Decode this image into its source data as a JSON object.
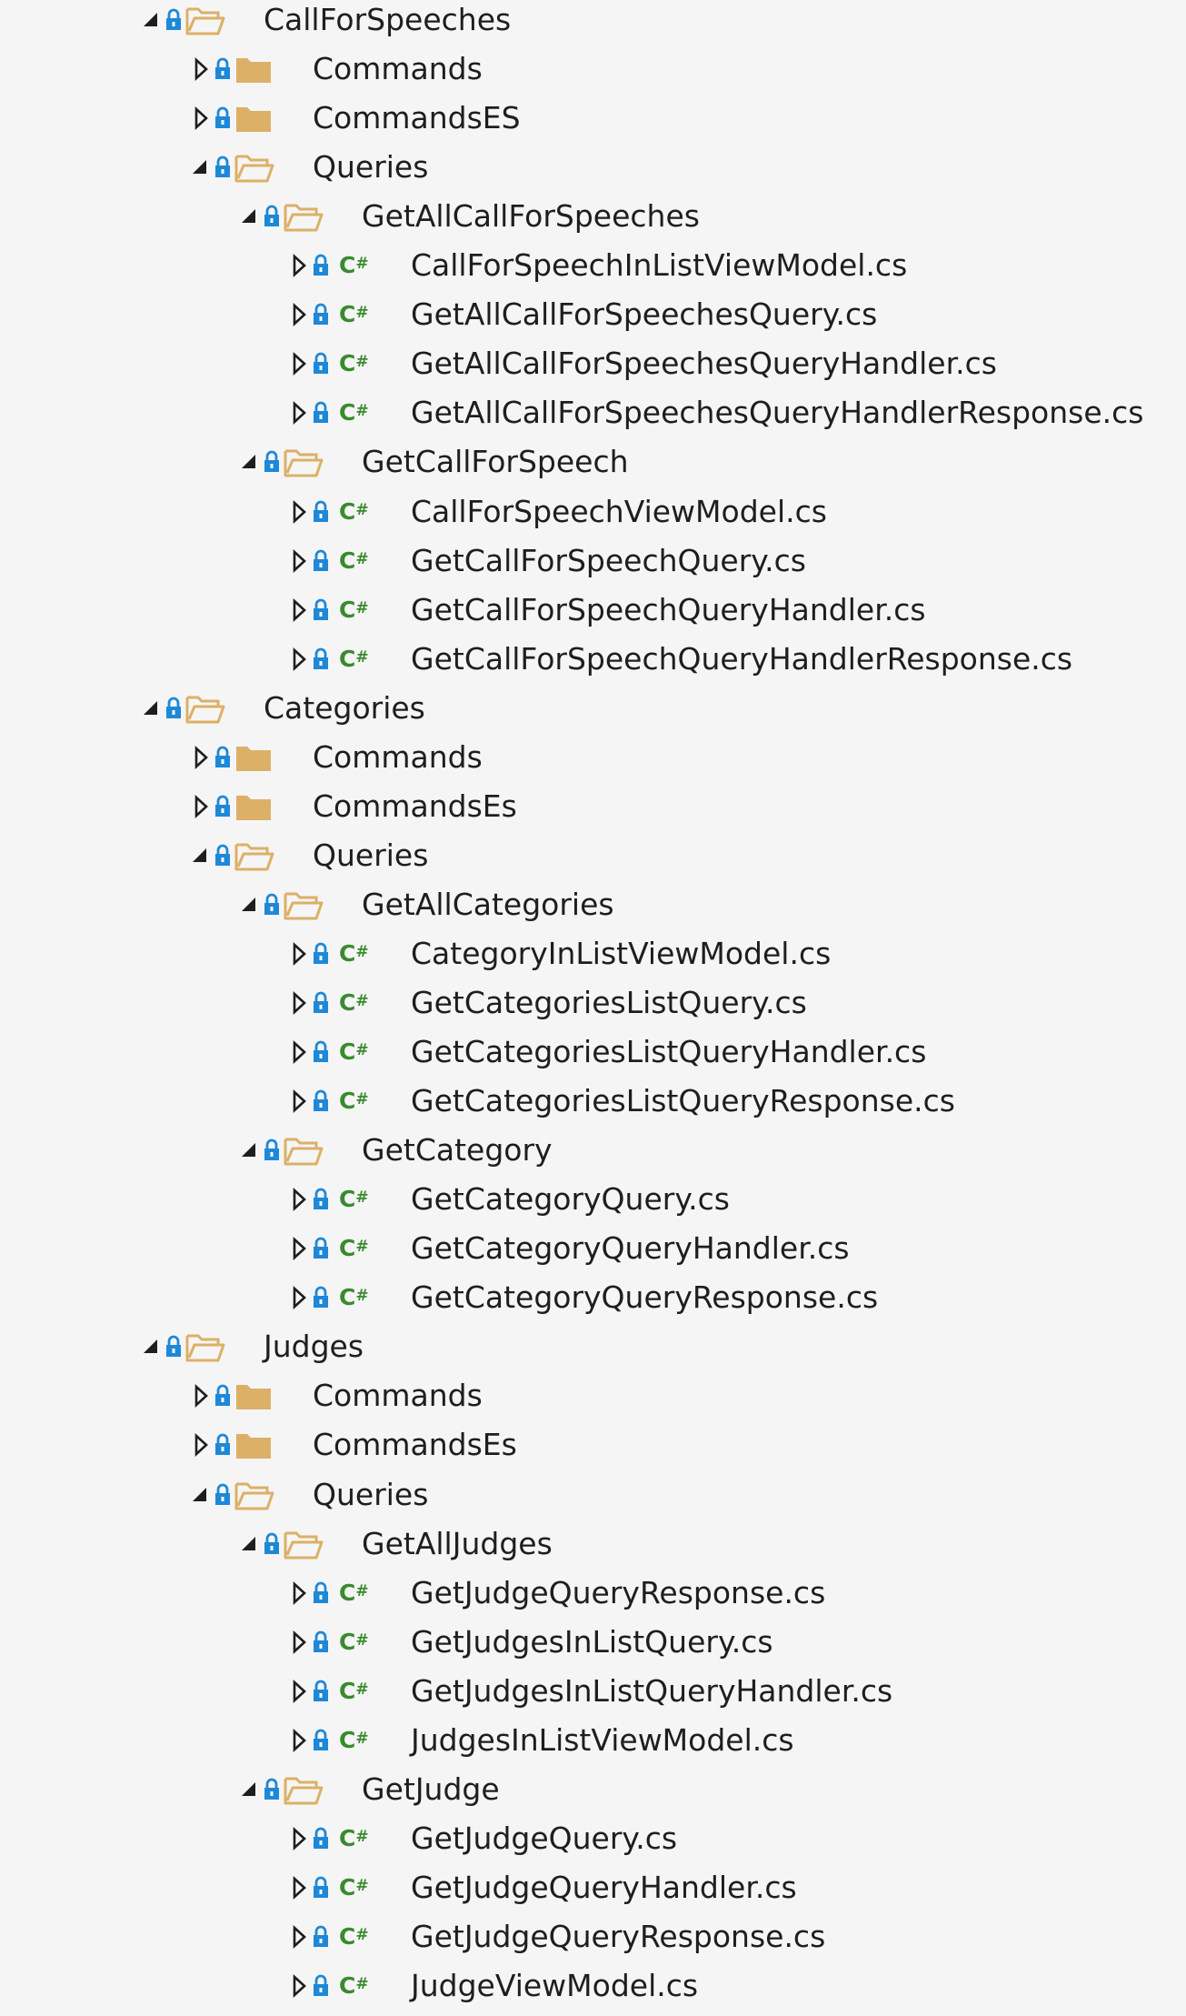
{
  "solution_explorer": {
    "items": [
      {
        "label": "CallForSpeeches",
        "level": 0,
        "type": "folder",
        "expanded": true
      },
      {
        "label": "Commands",
        "level": 1,
        "type": "folder",
        "expanded": false
      },
      {
        "label": "CommandsES",
        "level": 1,
        "type": "folder",
        "expanded": false
      },
      {
        "label": "Queries",
        "level": 1,
        "type": "folder",
        "expanded": true
      },
      {
        "label": "GetAllCallForSpeeches",
        "level": 2,
        "type": "folder",
        "expanded": true
      },
      {
        "label": "CallForSpeechInListViewModel.cs",
        "level": 3,
        "type": "csharp",
        "expanded": false
      },
      {
        "label": "GetAllCallForSpeechesQuery.cs",
        "level": 3,
        "type": "csharp",
        "expanded": false
      },
      {
        "label": "GetAllCallForSpeechesQueryHandler.cs",
        "level": 3,
        "type": "csharp",
        "expanded": false
      },
      {
        "label": "GetAllCallForSpeechesQueryHandlerResponse.cs",
        "level": 3,
        "type": "csharp",
        "expanded": false
      },
      {
        "label": "GetCallForSpeech",
        "level": 2,
        "type": "folder",
        "expanded": true
      },
      {
        "label": "CallForSpeechViewModel.cs",
        "level": 3,
        "type": "csharp",
        "expanded": false
      },
      {
        "label": "GetCallForSpeechQuery.cs",
        "level": 3,
        "type": "csharp",
        "expanded": false
      },
      {
        "label": "GetCallForSpeechQueryHandler.cs",
        "level": 3,
        "type": "csharp",
        "expanded": false
      },
      {
        "label": "GetCallForSpeechQueryHandlerResponse.cs",
        "level": 3,
        "type": "csharp",
        "expanded": false
      },
      {
        "label": "Categories",
        "level": 0,
        "type": "folder",
        "expanded": true
      },
      {
        "label": "Commands",
        "level": 1,
        "type": "folder",
        "expanded": false
      },
      {
        "label": "CommandsEs",
        "level": 1,
        "type": "folder",
        "expanded": false
      },
      {
        "label": "Queries",
        "level": 1,
        "type": "folder",
        "expanded": true
      },
      {
        "label": "GetAllCategories",
        "level": 2,
        "type": "folder",
        "expanded": true
      },
      {
        "label": "CategoryInListViewModel.cs",
        "level": 3,
        "type": "csharp",
        "expanded": false
      },
      {
        "label": "GetCategoriesListQuery.cs",
        "level": 3,
        "type": "csharp",
        "expanded": false
      },
      {
        "label": "GetCategoriesListQueryHandler.cs",
        "level": 3,
        "type": "csharp",
        "expanded": false
      },
      {
        "label": "GetCategoriesListQueryResponse.cs",
        "level": 3,
        "type": "csharp",
        "expanded": false
      },
      {
        "label": "GetCategory",
        "level": 2,
        "type": "folder",
        "expanded": true
      },
      {
        "label": "GetCategoryQuery.cs",
        "level": 3,
        "type": "csharp",
        "expanded": false
      },
      {
        "label": "GetCategoryQueryHandler.cs",
        "level": 3,
        "type": "csharp",
        "expanded": false
      },
      {
        "label": "GetCategoryQueryResponse.cs",
        "level": 3,
        "type": "csharp",
        "expanded": false
      },
      {
        "label": "Judges",
        "level": 0,
        "type": "folder",
        "expanded": true
      },
      {
        "label": "Commands",
        "level": 1,
        "type": "folder",
        "expanded": false
      },
      {
        "label": "CommandsEs",
        "level": 1,
        "type": "folder",
        "expanded": false
      },
      {
        "label": "Queries",
        "level": 1,
        "type": "folder",
        "expanded": true
      },
      {
        "label": "GetAllJudges",
        "level": 2,
        "type": "folder",
        "expanded": true
      },
      {
        "label": "GetJudgeQueryResponse.cs",
        "level": 3,
        "type": "csharp",
        "expanded": false
      },
      {
        "label": "GetJudgesInListQuery.cs",
        "level": 3,
        "type": "csharp",
        "expanded": false
      },
      {
        "label": "GetJudgesInListQueryHandler.cs",
        "level": 3,
        "type": "csharp",
        "expanded": false
      },
      {
        "label": "JudgesInListViewModel.cs",
        "level": 3,
        "type": "csharp",
        "expanded": false
      },
      {
        "label": "GetJudge",
        "level": 2,
        "type": "folder",
        "expanded": true
      },
      {
        "label": "GetJudgeQuery.cs",
        "level": 3,
        "type": "csharp",
        "expanded": false
      },
      {
        "label": "GetJudgeQueryHandler.cs",
        "level": 3,
        "type": "csharp",
        "expanded": false
      },
      {
        "label": "GetJudgeQueryResponse.cs",
        "level": 3,
        "type": "csharp",
        "expanded": false
      },
      {
        "label": "JudgeViewModel.cs",
        "level": 3,
        "type": "csharp",
        "expanded": false
      }
    ]
  },
  "icons": {
    "expanded": "triangle-down-right-icon",
    "collapsed": "triangle-right-outline-icon",
    "lock": "lock-icon",
    "folder_open": "open-folder-icon",
    "folder_closed": "closed-folder-icon",
    "csharp": "csharp-file-icon"
  },
  "colors": {
    "background": "#f5f5f5",
    "text": "#1e1e1e",
    "lock": "#1e88d8",
    "folder": "#dcb067",
    "csharp": "#3a8a2f",
    "expander": "#1e1e1e"
  },
  "csharp_icon_text": {
    "letter": "C",
    "symbol": "#"
  }
}
